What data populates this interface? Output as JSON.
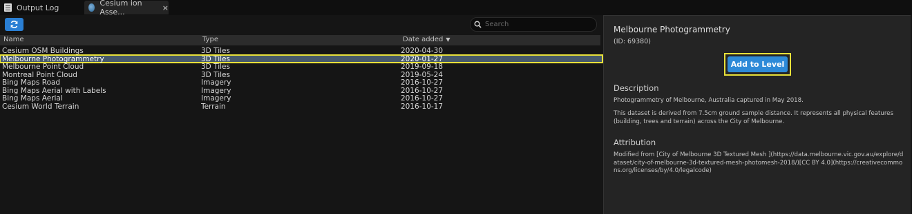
{
  "tabs": [
    {
      "label": "Output Log",
      "icon": "log-icon"
    },
    {
      "label": "Cesium ion Asse...",
      "icon": "globe-icon",
      "close": "×"
    }
  ],
  "toolbar": {
    "refresh_icon": "refresh-icon",
    "search_placeholder": "Search"
  },
  "table": {
    "headers": {
      "name": "Name",
      "type": "Type",
      "date": "Date added",
      "sort": "▼"
    },
    "rows": [
      {
        "name": "Cesium OSM Buildings",
        "type": "3D Tiles",
        "date": "2020-04-30"
      },
      {
        "name": "Melbourne Photogrammetry",
        "type": "3D Tiles",
        "date": "2020-01-27"
      },
      {
        "name": "Melbourne Point Cloud",
        "type": "3D Tiles",
        "date": "2019-09-18"
      },
      {
        "name": "Montreal Point Cloud",
        "type": "3D Tiles",
        "date": "2019-05-24"
      },
      {
        "name": "Bing Maps Road",
        "type": "Imagery",
        "date": "2016-10-27"
      },
      {
        "name": "Bing Maps Aerial with Labels",
        "type": "Imagery",
        "date": "2016-10-27"
      },
      {
        "name": "Bing Maps Aerial",
        "type": "Imagery",
        "date": "2016-10-27"
      },
      {
        "name": "Cesium World Terrain",
        "type": "Terrain",
        "date": "2016-10-17"
      }
    ]
  },
  "details": {
    "title": "Melbourne Photogrammetry",
    "id_text": "(ID: 69380)",
    "add_button": "Add to Level",
    "description_heading": "Description",
    "description_1": "Photogrammetry of Melbourne, Australia captured in May 2018.",
    "description_2": "This dataset is derived from 7.5cm ground sample distance. It represents all physical features (building, trees and terrain) across the City of Melbourne.",
    "attribution_heading": "Attribution",
    "attribution": "Modified from [City of Melbourne 3D Textured Mesh ](https://data.melbourne.vic.gov.au/explore/dataset/city-of-melbourne-3d-textured-mesh-photomesh-2018/)[CC BY 4.0](https://creativecommons.org/licenses/by/4.0/legalcode)"
  },
  "colors": {
    "accent": "#2d8ad8",
    "highlight": "#e8e13a",
    "selected_row": "#46596b"
  }
}
